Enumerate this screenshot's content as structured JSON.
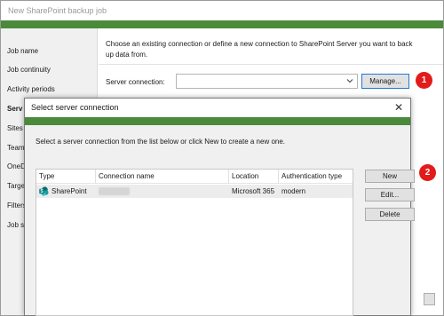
{
  "wizard": {
    "title": "New SharePoint backup job",
    "nav": [
      {
        "label": "Job name",
        "active": false
      },
      {
        "label": "Job continuity",
        "active": false
      },
      {
        "label": "Activity periods",
        "active": false
      },
      {
        "label": "Serv",
        "active": true
      },
      {
        "label": "Sites",
        "active": false
      },
      {
        "label": "Team",
        "active": false
      },
      {
        "label": "OneD",
        "active": false
      },
      {
        "label": "Targe",
        "active": false
      },
      {
        "label": "Filters",
        "active": false
      },
      {
        "label": "Job su",
        "active": false
      }
    ],
    "intro_line1": "Choose an existing connection or define a new connection to SharePoint Server you want to back",
    "intro_line2": "up data from.",
    "server_connection_label": "Server connection:",
    "server_connection_value": "",
    "manage_label": "Manage..."
  },
  "callouts": {
    "first": "1",
    "second": "2"
  },
  "dialog": {
    "title": "Select server connection",
    "close_glyph": "✕",
    "instruction": "Select a server connection from the list below or click New to create a new one.",
    "columns": [
      "Type",
      "Connection name",
      "Location",
      "Authentication type"
    ],
    "rows": [
      {
        "type": "SharePoint",
        "connection_name": "",
        "location": "Microsoft 365",
        "auth": "modern"
      }
    ],
    "buttons": {
      "new": "New",
      "edit": "Edit...",
      "delete": "Delete"
    }
  },
  "colors": {
    "accent": "#4b8a3b",
    "callout": "#e31b1b",
    "focus": "#1e7ad4"
  },
  "icons": {
    "dropdown": "chevron-down-icon",
    "close": "close-icon",
    "sharepoint": "sharepoint-icon"
  }
}
